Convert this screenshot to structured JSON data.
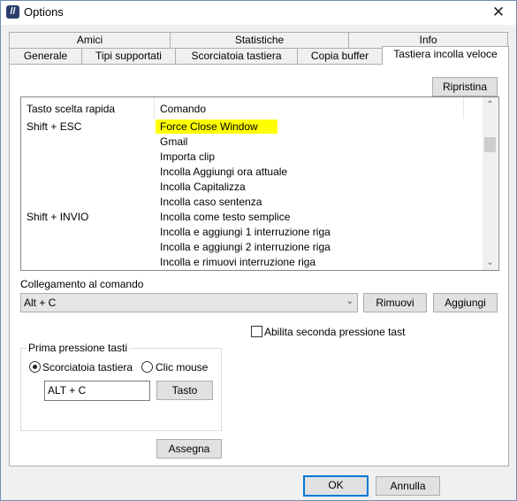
{
  "window": {
    "title": "Options",
    "close_glyph": "✕"
  },
  "tabs_row1": [
    "Amici",
    "Statistiche",
    "Info"
  ],
  "tabs_row2": [
    "Generale",
    "Tipi supportati",
    "Scorciatoia tastiera",
    "Copia buffer",
    "Tastiera incolla veloce"
  ],
  "panel": {
    "reset_label": "Ripristina",
    "list": {
      "headers": [
        "Tasto scelta rapida",
        "Comando"
      ],
      "rows": [
        {
          "key": "Shift + ESC",
          "command": "Force Close Window"
        },
        {
          "key": "",
          "command": "Gmail"
        },
        {
          "key": "",
          "command": "Importa clip"
        },
        {
          "key": "",
          "command": "Incolla Aggiungi ora attuale"
        },
        {
          "key": "",
          "command": "Incolla Capitalizza"
        },
        {
          "key": "",
          "command": "Incolla caso sentenza"
        },
        {
          "key": "Shift + INVIO",
          "command": "Incolla come testo semplice"
        },
        {
          "key": "",
          "command": "Incolla e aggiungi 1 interruzione riga"
        },
        {
          "key": "",
          "command": "Incolla e aggiungi 2 interruzione riga"
        },
        {
          "key": "",
          "command": "Incolla e rimuovi interruzione riga"
        }
      ],
      "highlight_color": "#ffff00",
      "scroll_up_glyph": "⌃",
      "scroll_down_glyph": "⌄"
    },
    "link_label": "Collegamento al comando",
    "link_value": "Alt + C",
    "combo_arrow_glyph": "⌄",
    "remove_label": "Rimuovi",
    "add_label": "Aggiungi",
    "second_press_label": "Abilita seconda pressione tast",
    "first_press_group": {
      "title": "Prima pressione tasti",
      "radio_keyboard": "Scorciatoia tastiera",
      "radio_mouse": "Clic mouse",
      "key_value": "ALT + C",
      "key_button": "Tasto"
    },
    "assign_label": "Assegna"
  },
  "footer": {
    "ok_label": "OK",
    "cancel_label": "Annulla",
    "ok_border_color": "#0078d7"
  }
}
